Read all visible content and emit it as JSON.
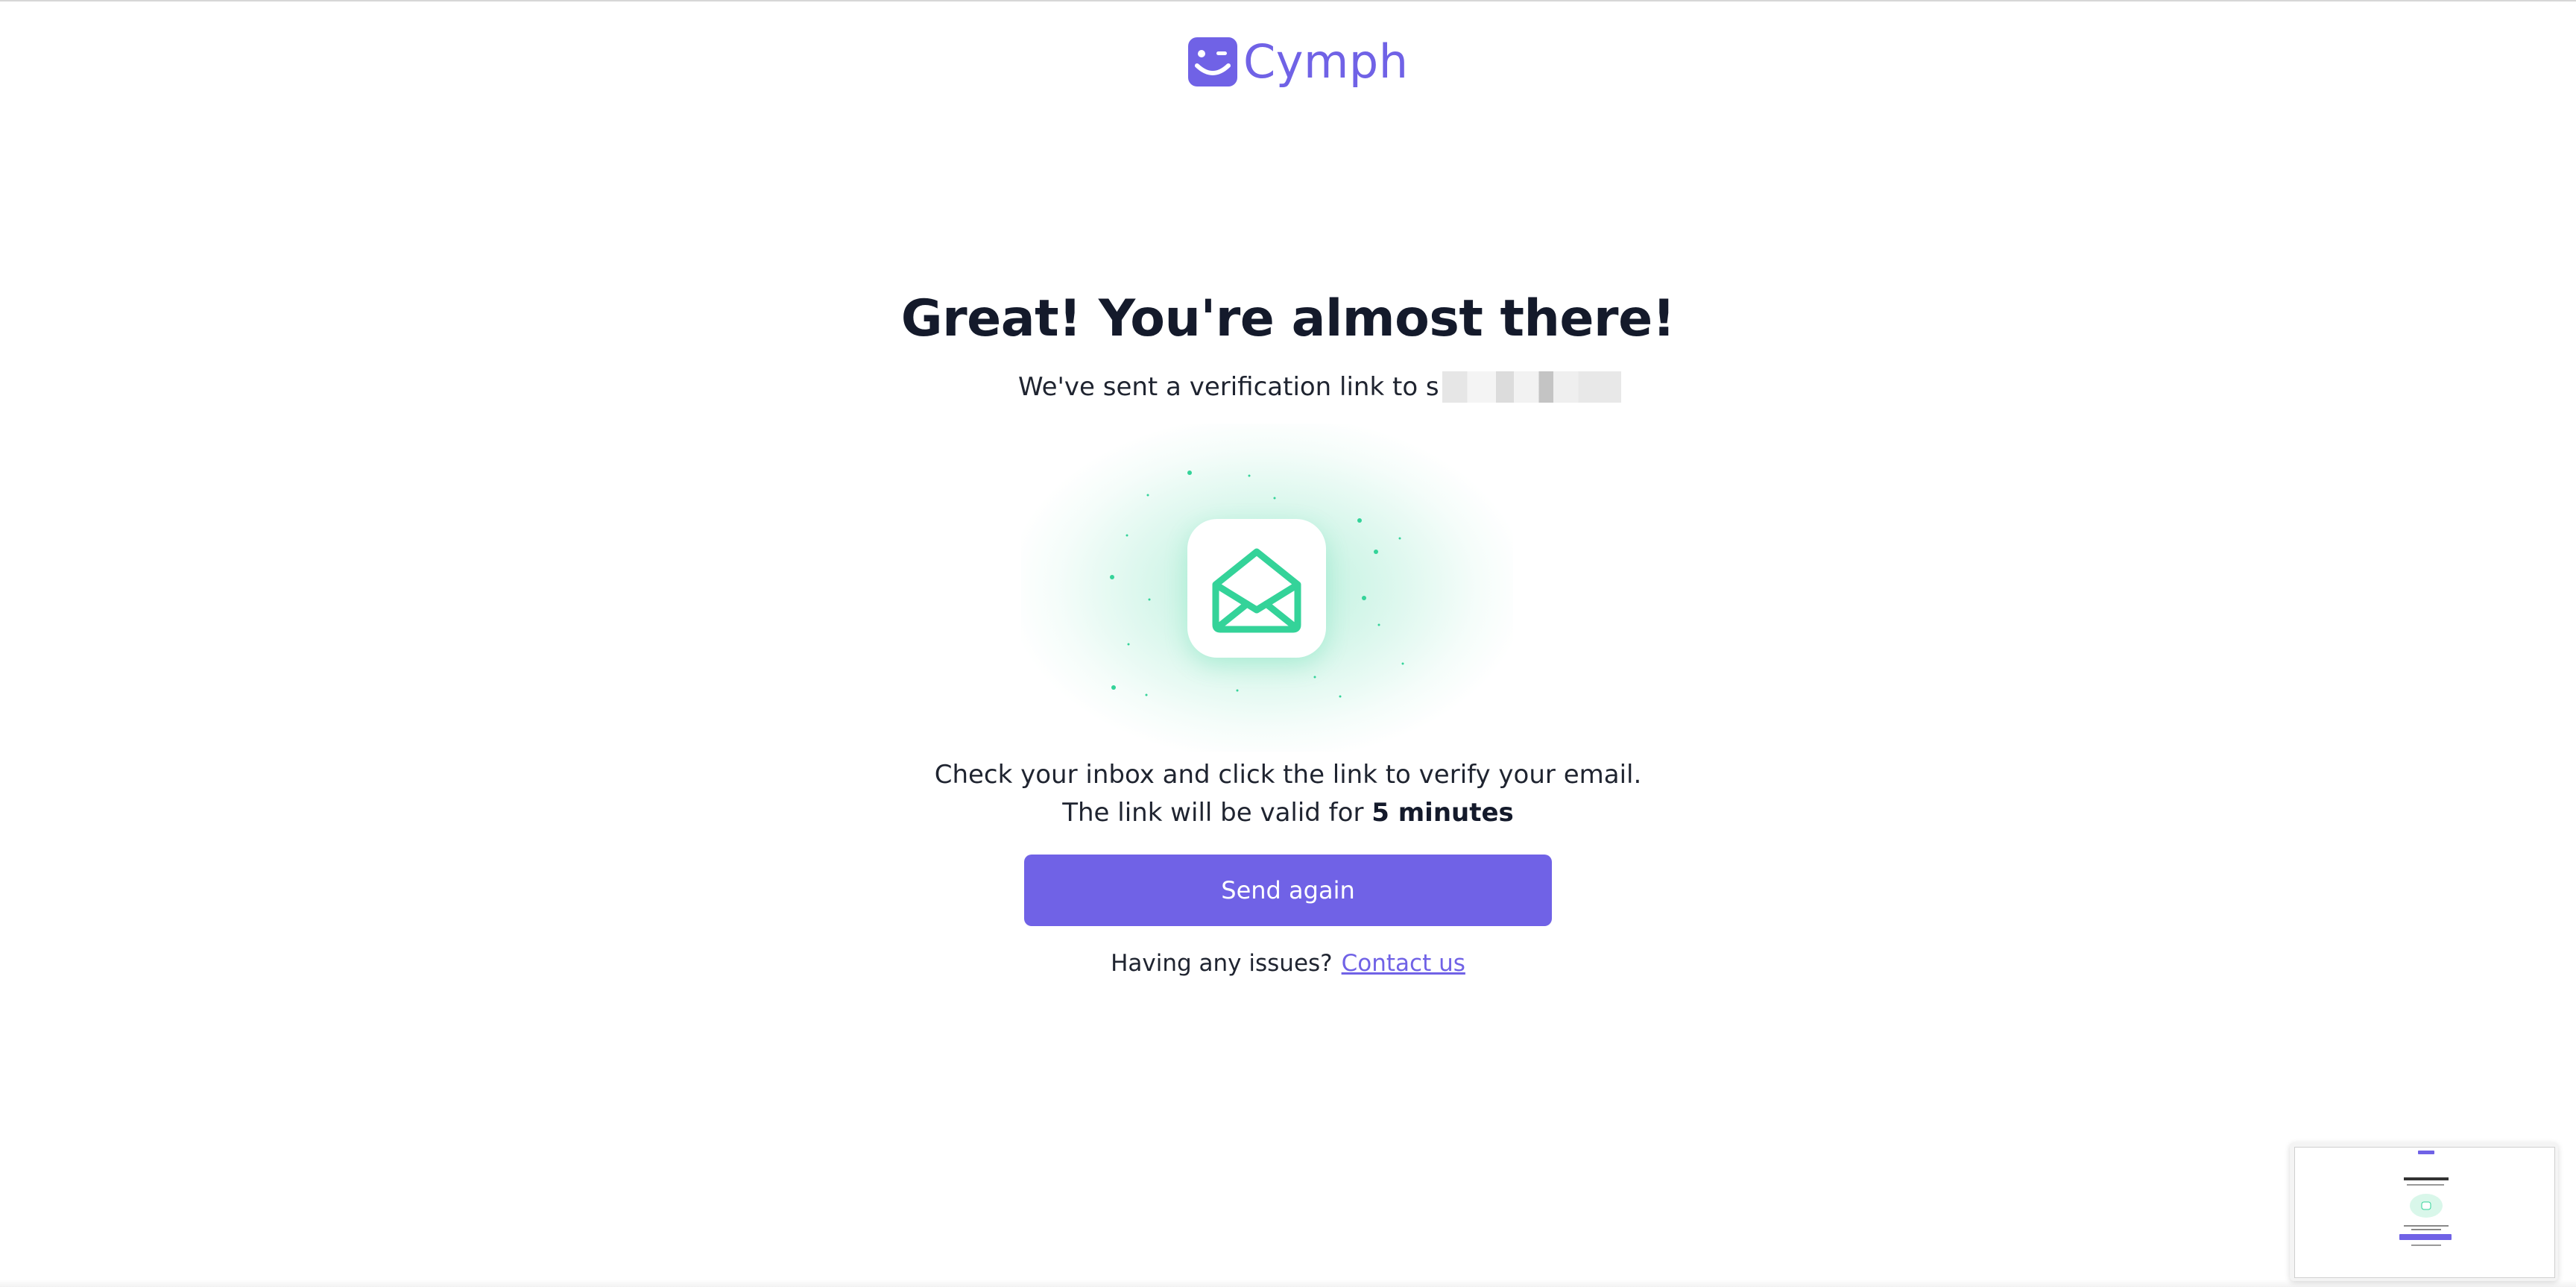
{
  "brand": {
    "name": "Cymph",
    "accent_color": "#7062e6",
    "logo_icon": "smiley-face-icon"
  },
  "main": {
    "title": "Great! You're almost there!",
    "sent_prefix": "We've sent a verification link to s",
    "email_redacted": "",
    "mail_icon": "open-envelope-icon",
    "instruction_line1": "Check your inbox and click the link to verify your email.",
    "validity_prefix": "The link will be valid for ",
    "validity_value": "5 minutes",
    "send_again_label": "Send again",
    "help_text": "Having any issues?",
    "contact_link": "Contact us",
    "success_color": "#34d399"
  },
  "overlay": {
    "thumbnail": "screenshot-preview"
  }
}
